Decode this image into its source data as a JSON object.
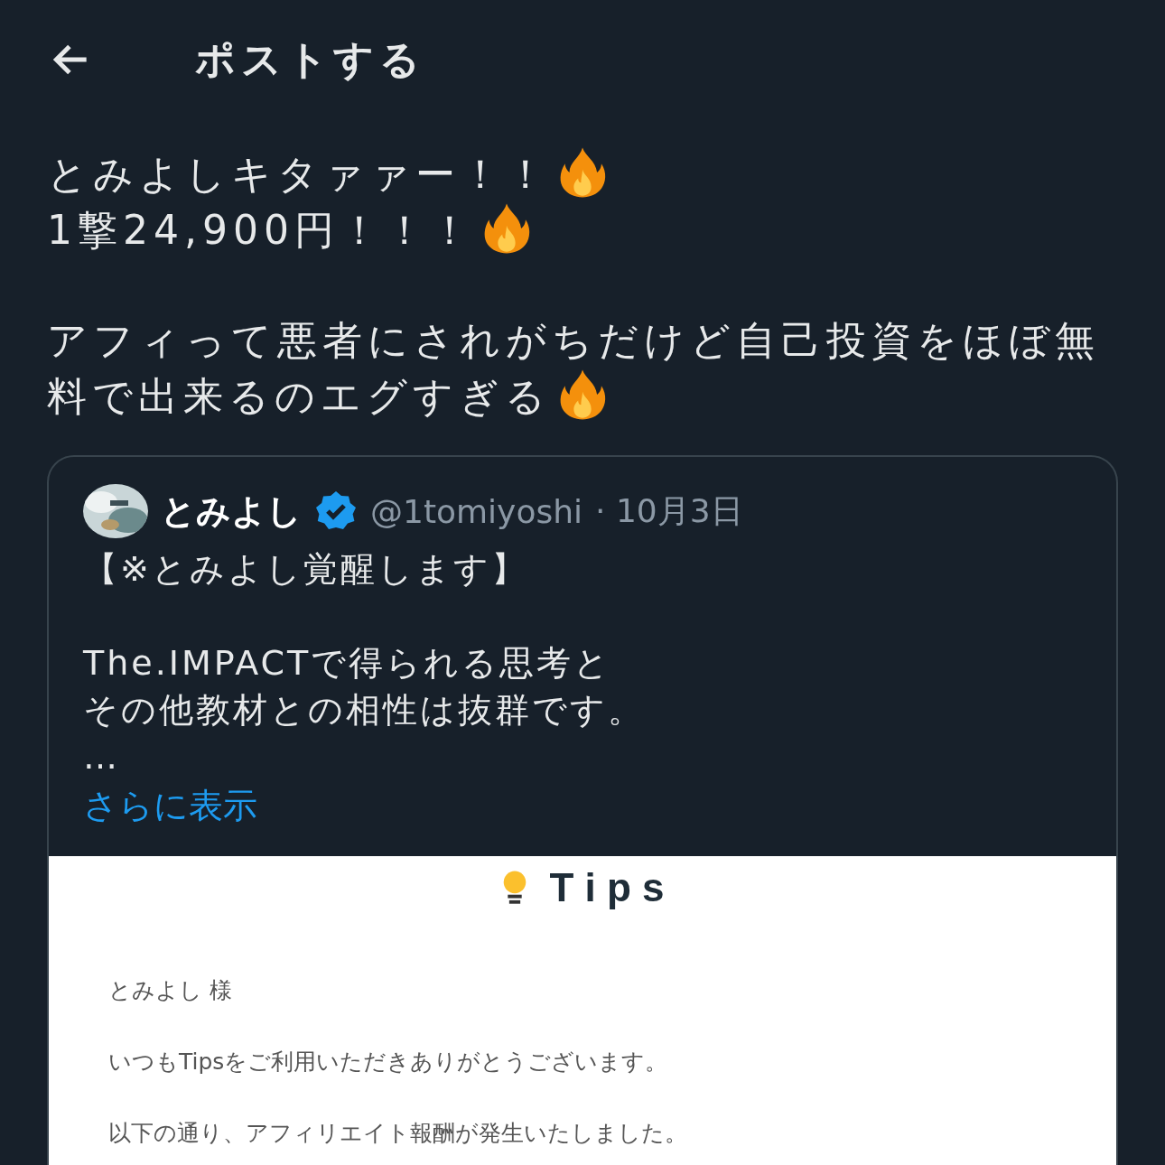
{
  "header": {
    "title": "ポストする"
  },
  "post": {
    "paragraphs": [
      [
        {
          "text": "とみよしキタァァー！！",
          "fire": true
        },
        {
          "text": "1撃24,900円！！！",
          "fire": true
        }
      ],
      [
        {
          "text": "アフィって悪者にされがちだけど自己投資をほぼ無料で出来るのエグすぎる",
          "fire": true
        }
      ]
    ]
  },
  "quote": {
    "name": "とみよし",
    "verified": true,
    "handle": "@1tomiyoshi",
    "date": "· 10月3日",
    "body": [
      [
        "【※とみよし覚醒します】"
      ],
      [
        "The.IMPACTで得られる思考と",
        "その他教材との相性は抜群です。",
        "…"
      ]
    ],
    "more_link": "さらに表示",
    "email": {
      "brand": "T i p s",
      "greeting": "とみよし 様",
      "lines": [
        "いつもTipsをご利用いただきありがとうございます。",
        "以下の通り、アフィリエイト報酬が発生いたしました。"
      ]
    }
  }
}
